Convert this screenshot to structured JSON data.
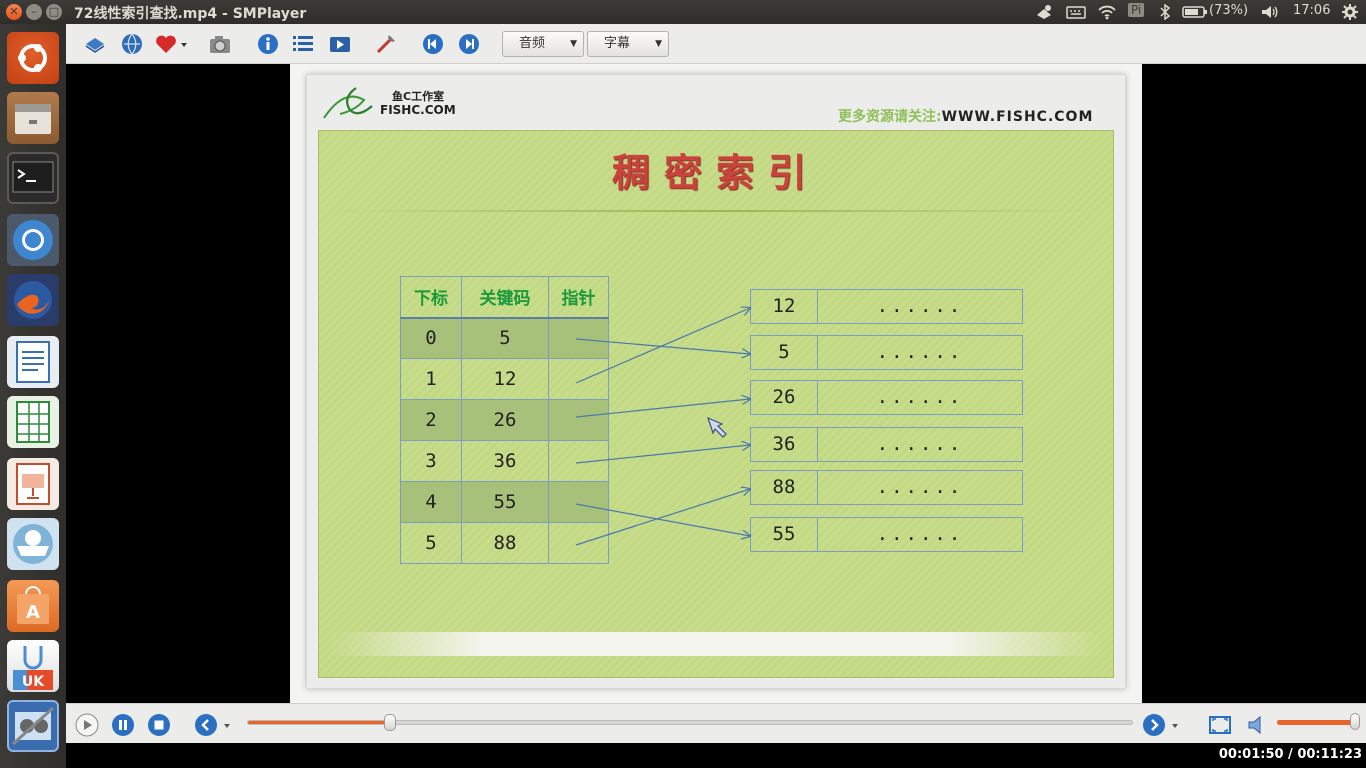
{
  "window": {
    "title": "72线性索引查找.mp4 - SMPlayer"
  },
  "tray": {
    "battery": "(73%)",
    "clock": "17:06",
    "input_method": "Pi"
  },
  "toolbar": {
    "audio_label": "音频",
    "subtitle_label": "字幕"
  },
  "slide": {
    "logo_text": "鱼C工作室",
    "logo_sub": "FISHC.COM",
    "site_prefix": "更多资源请关注:",
    "site_url": "WWW.FISHC.COM",
    "title": "稠密索引",
    "table": {
      "headers": [
        "下标",
        "关键码",
        "指针"
      ],
      "rows": [
        {
          "index": "0",
          "key": "5"
        },
        {
          "index": "1",
          "key": "12"
        },
        {
          "index": "2",
          "key": "26"
        },
        {
          "index": "3",
          "key": "36"
        },
        {
          "index": "4",
          "key": "55"
        },
        {
          "index": "5",
          "key": "88"
        }
      ]
    },
    "records": [
      {
        "key": "12",
        "value": "......"
      },
      {
        "key": "5",
        "value": "......"
      },
      {
        "key": "26",
        "value": "......"
      },
      {
        "key": "36",
        "value": "......"
      },
      {
        "key": "88",
        "value": "......"
      },
      {
        "key": "55",
        "value": "......"
      }
    ]
  },
  "player": {
    "time": "00:01:50 / 00:11:23",
    "progress": 0.161,
    "volume": 0.97
  },
  "colors": {
    "accent": "#e8642a",
    "title_red": "#c9423c",
    "header_green": "#1b9a3c",
    "slide_green": "#c7dd8a"
  }
}
